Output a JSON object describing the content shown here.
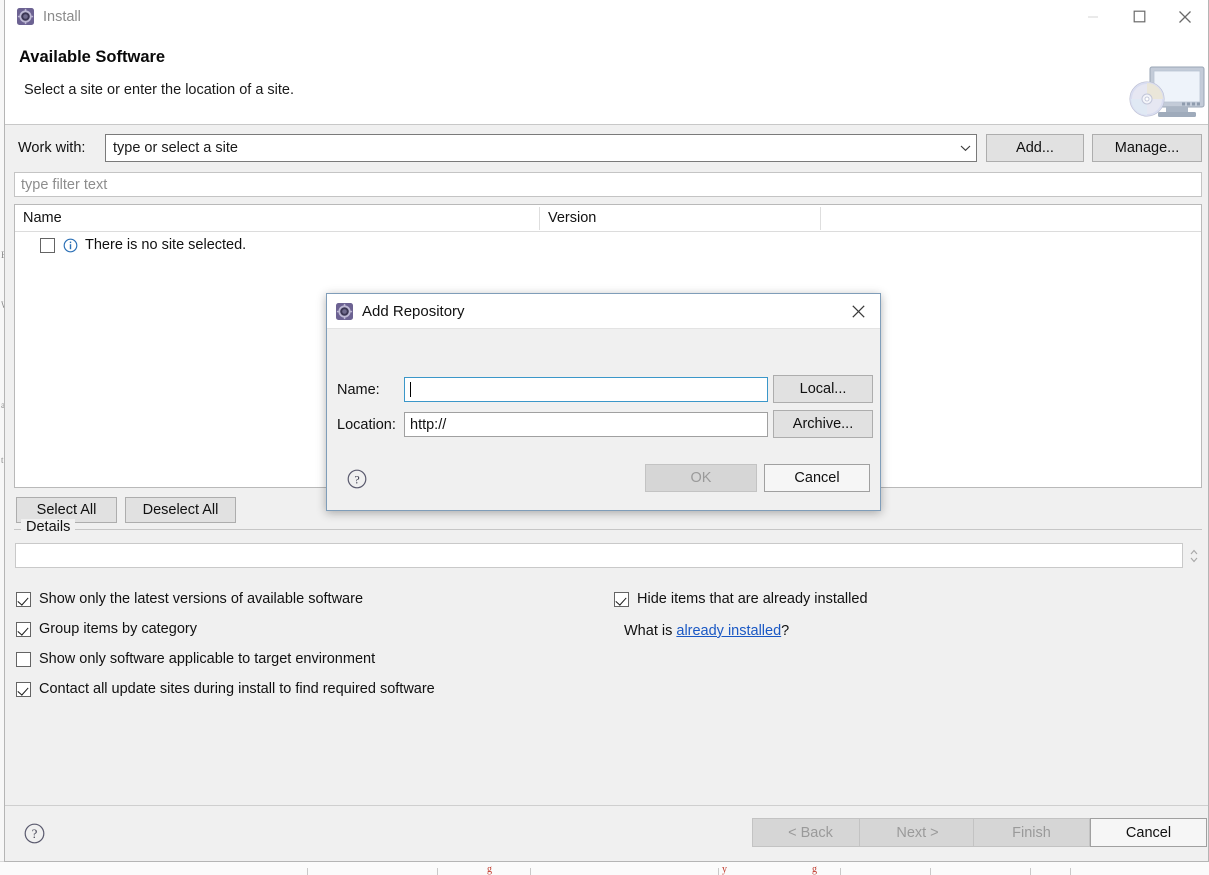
{
  "window": {
    "title": "Install",
    "icon": "eclipse-icon",
    "controls": {
      "minimize": "minimize-icon",
      "maximize": "maximize-icon",
      "close": "close-icon"
    }
  },
  "header": {
    "title": "Available Software",
    "description": "Select a site or enter the location of a site.",
    "banner_icon": "monitor-disc-icon"
  },
  "work_with": {
    "label": "Work with:",
    "value": "type or select a site",
    "dropdown_icon": "chevron-down-icon",
    "add_button": "Add...",
    "manage_button": "Manage..."
  },
  "filter": {
    "placeholder": "type filter text",
    "value": ""
  },
  "table": {
    "columns": [
      "Name",
      "Version"
    ],
    "rows": [
      {
        "checked": false,
        "icon": "info-icon",
        "name": "There is no site selected.",
        "version": ""
      }
    ]
  },
  "selection_buttons": {
    "select_all": "Select All",
    "deselect_all": "Deselect All"
  },
  "details": {
    "legend": "Details",
    "value": "",
    "grip_icon": "resize-grip-icon"
  },
  "options": {
    "left": [
      {
        "label": "Show only the latest versions of available software",
        "checked": true
      },
      {
        "label": "Group items by category",
        "checked": true
      },
      {
        "label": "Show only software applicable to target environment",
        "checked": false
      },
      {
        "label": "Contact all update sites during install to find required software",
        "checked": true
      }
    ],
    "right": [
      {
        "label": "Hide items that are already installed",
        "checked": true
      }
    ],
    "right_note": {
      "prefix": "What is ",
      "link": "already installed",
      "suffix": "?"
    }
  },
  "wizard_footer": {
    "help_icon": "help-icon",
    "back": "< Back",
    "next": "Next >",
    "finish": "Finish",
    "cancel": "Cancel",
    "back_enabled": false,
    "next_enabled": false,
    "finish_enabled": false,
    "cancel_enabled": true
  },
  "add_repository_dialog": {
    "title": "Add Repository",
    "icon": "eclipse-icon",
    "close_icon": "close-icon",
    "name_label": "Name:",
    "name_value": "",
    "location_label": "Location:",
    "location_value": "http://",
    "local_button": "Local...",
    "archive_button": "Archive...",
    "help_icon": "help-icon",
    "ok_button": "OK",
    "cancel_button": "Cancel",
    "ok_enabled": false
  },
  "colors": {
    "accent_focus_border": "#3b97c9",
    "link": "#1a58c4",
    "info_icon": "#2a6fb5",
    "window_chrome": "#f0f0f0",
    "dialog_border": "#7f9db9",
    "disabled_text": "#9a9a9a"
  }
}
